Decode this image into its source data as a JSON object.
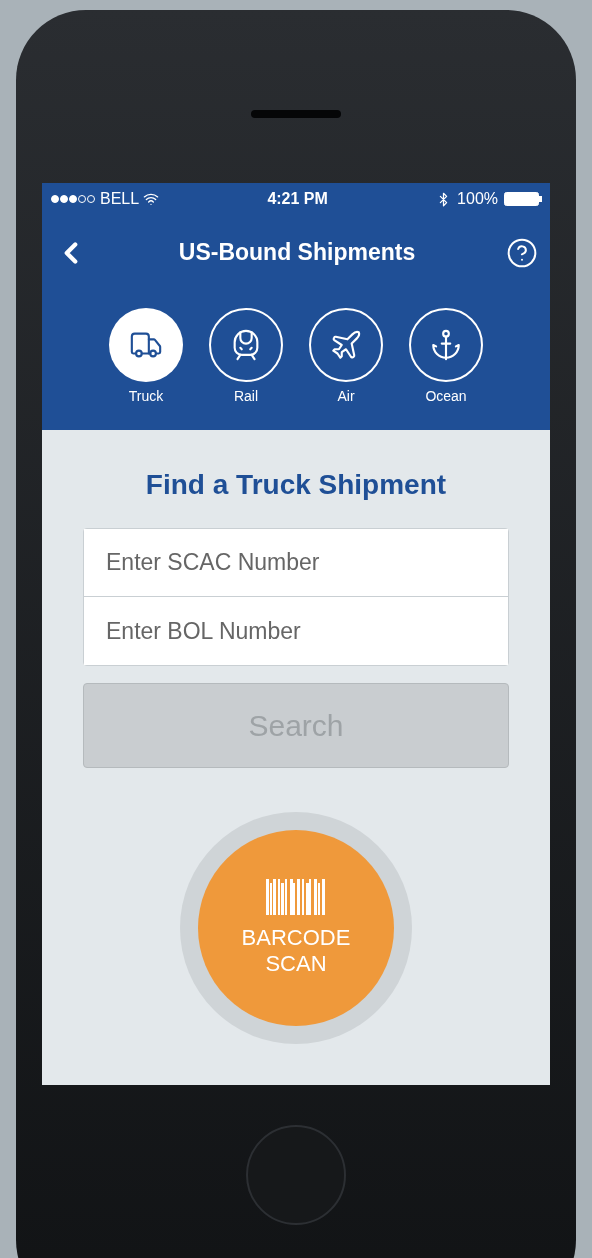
{
  "status_bar": {
    "carrier": "BELL",
    "time": "4:21 PM",
    "battery": "100%"
  },
  "header": {
    "title": "US-Bound Shipments"
  },
  "modes": [
    {
      "kind": "truck",
      "label": "Truck",
      "selected": true
    },
    {
      "kind": "rail",
      "label": "Rail",
      "selected": false
    },
    {
      "kind": "air",
      "label": "Air",
      "selected": false
    },
    {
      "kind": "ocean",
      "label": "Ocean",
      "selected": false
    }
  ],
  "heading": "Find a Truck Shipment",
  "fields": [
    {
      "placeholder": "Enter SCAC Number"
    },
    {
      "placeholder": "Enter BOL Number"
    }
  ],
  "search_button": {
    "label": "Search",
    "disabled": true
  },
  "barcode_button": {
    "label": "BARCODE SCAN"
  }
}
